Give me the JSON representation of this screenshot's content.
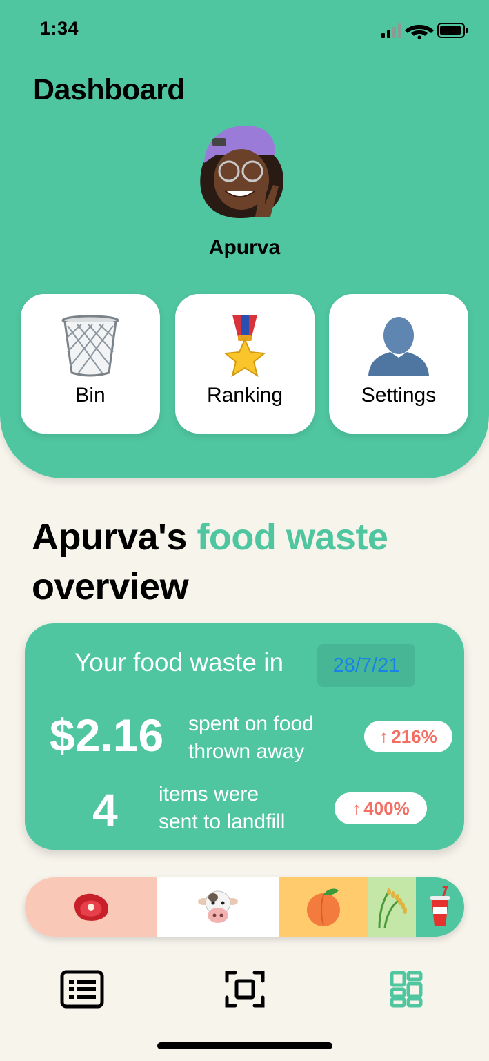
{
  "status_bar": {
    "time": "1:34",
    "icons": [
      "signal-icon",
      "wifi-icon",
      "battery-icon"
    ]
  },
  "header": {
    "title": "Dashboard",
    "user_name": "Apurva",
    "avatar": "memoji-avatar"
  },
  "tiles": [
    {
      "label": "Bin",
      "icon": "wastebasket-icon"
    },
    {
      "label": "Ranking",
      "icon": "medal-icon"
    },
    {
      "label": "Settings",
      "icon": "person-silhouette-icon"
    }
  ],
  "overview": {
    "title_prefix": "Apurva's ",
    "title_accent": "food waste",
    "title_suffix": "overview"
  },
  "card": {
    "heading": "Your food waste in",
    "date": "28/7/21",
    "stats": [
      {
        "value": "$2.16",
        "line1": "spent on food",
        "line2": "thrown away",
        "arrow": "↑",
        "change": "216%"
      },
      {
        "value": "4",
        "line1": "items were",
        "line2": "sent to landfill",
        "arrow": "↑",
        "change": "400%"
      }
    ]
  },
  "breakdown": [
    {
      "icon": "steak-icon",
      "color": "#fac8b7",
      "share": 0.3
    },
    {
      "icon": "cow-icon",
      "color": "#ffffff",
      "share": 0.28
    },
    {
      "icon": "peach-icon",
      "color": "#ffcb6d",
      "share": 0.2
    },
    {
      "icon": "rice-plant-icon",
      "color": "#c4e6a6",
      "share": 0.11
    },
    {
      "icon": "drink-cup-icon",
      "color": "#4fc6a0",
      "share": 0.11
    }
  ],
  "tab_bar": {
    "tabs": [
      {
        "icon": "list-icon",
        "active": false
      },
      {
        "icon": "scan-icon",
        "active": false
      },
      {
        "icon": "dashboard-icon",
        "active": true
      }
    ],
    "active_color": "#4fc6a0"
  },
  "colors": {
    "brand": "#4fc6a0",
    "background": "#f7f4ec",
    "increase": "#f36e63",
    "date_text": "#1a82e6"
  }
}
